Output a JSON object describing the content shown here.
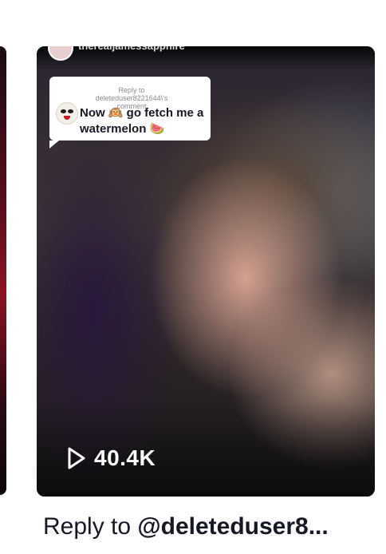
{
  "creator": {
    "username": "therealjamessapphire"
  },
  "reply_bubble": {
    "header": "Reply to deleteduser8221644\\'s comment",
    "comment_text": "Now 🙉 go fetch me a watermelon 🍉"
  },
  "video": {
    "view_count": "40.4K",
    "play_icon": "play-icon"
  },
  "caption": {
    "prefix": "Reply to ",
    "handle": "@deleteduser8..."
  },
  "colors": {
    "text_primary": "#161823",
    "bubble_header": "#8a8b91",
    "card_dark": "#1b1a20"
  }
}
